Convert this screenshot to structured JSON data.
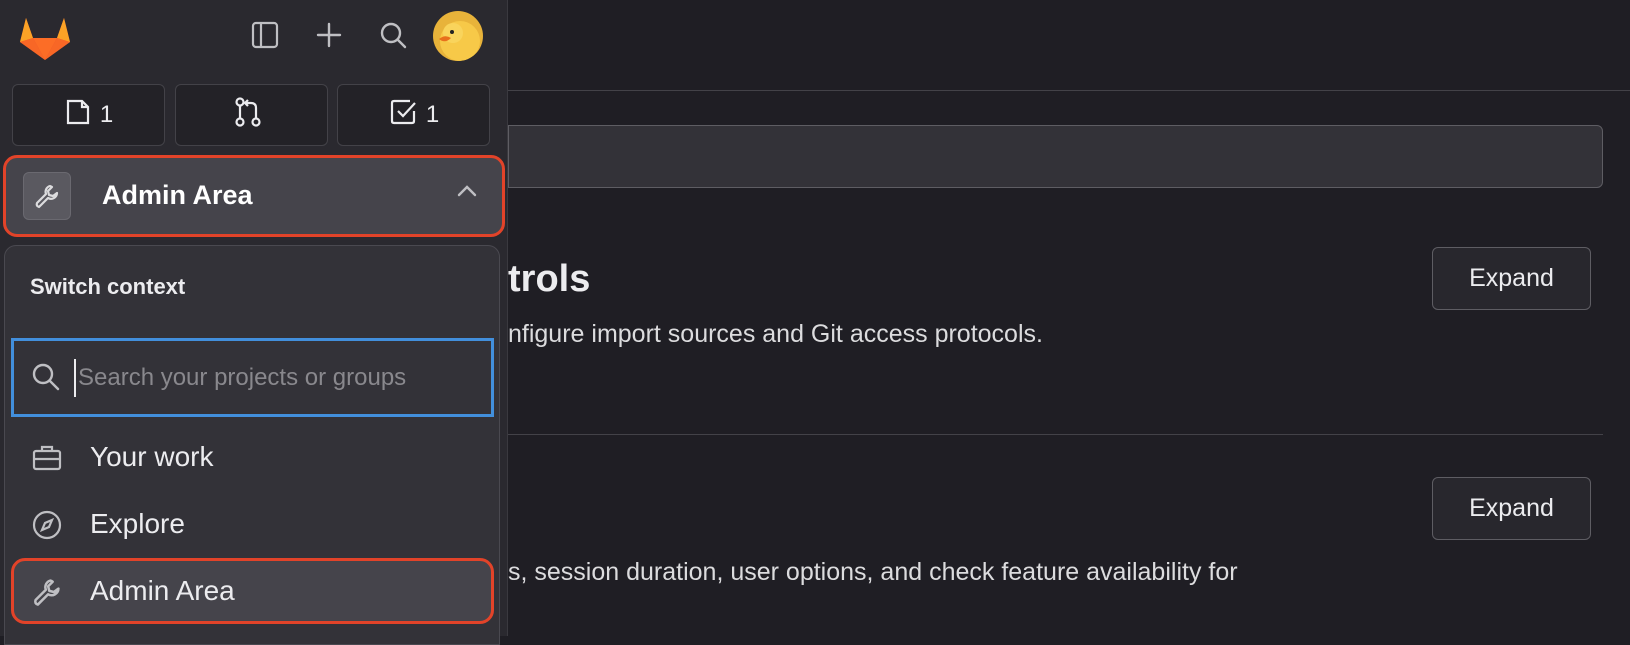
{
  "main": {
    "section1": {
      "title_fragment": "trols",
      "description_fragment": "nfigure import sources and Git access protocols.",
      "expand_label": "Expand"
    },
    "section2": {
      "description_fragment": "s, session duration, user options, and check feature availability for",
      "expand_label": "Expand"
    }
  },
  "sidebar": {
    "counts": {
      "issues": "1",
      "merge_requests": "",
      "todos": "1"
    },
    "context": {
      "label": "Admin Area"
    }
  },
  "dropdown": {
    "heading": "Switch context",
    "search_placeholder": "Search your projects or groups",
    "items": [
      {
        "label": "Your work",
        "icon": "briefcase-icon"
      },
      {
        "label": "Explore",
        "icon": "compass-icon"
      },
      {
        "label": "Admin Area",
        "icon": "wrench-icon"
      }
    ]
  },
  "colors": {
    "highlight": "#e24329",
    "focus": "#428fdc",
    "brand_orange": "#fc6d26"
  }
}
